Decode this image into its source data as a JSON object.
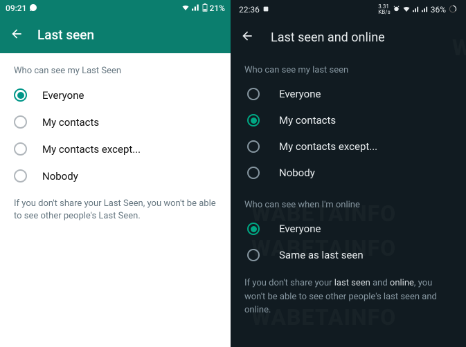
{
  "left": {
    "statusbar": {
      "time": "09:21",
      "battery": "21%"
    },
    "header": {
      "title": "Last seen"
    },
    "section_label": "Who can see my Last Seen",
    "options": {
      "everyone": "Everyone",
      "contacts": "My contacts",
      "except": "My contacts except...",
      "nobody": "Nobody"
    },
    "selected": "everyone",
    "helper": "If you don't share your Last Seen, you won't be able to see other people's Last Seen."
  },
  "right": {
    "statusbar": {
      "time": "22:36",
      "battery": "36%"
    },
    "header": {
      "title": "Last seen and online"
    },
    "section1_label": "Who can see my last seen",
    "options1": {
      "everyone": "Everyone",
      "contacts": "My contacts",
      "except": "My contacts except...",
      "nobody": "Nobody"
    },
    "selected1": "contacts",
    "section2_label": "Who can see when I'm online",
    "options2": {
      "everyone": "Everyone",
      "same": "Same as last seen"
    },
    "selected2": "everyone",
    "helper_pre": "If you don't share your ",
    "helper_hl1": "last seen",
    "helper_mid": " and ",
    "helper_hl2": "online",
    "helper_post": ", you won't be able to see other people's last seen and online."
  },
  "watermark": "WABETAINFO"
}
